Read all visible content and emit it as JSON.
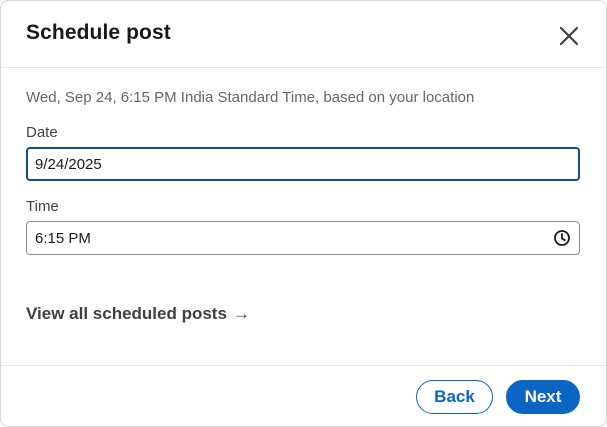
{
  "dialog": {
    "title": "Schedule post",
    "close_icon": "close-icon",
    "info_text": "Wed, Sep 24, 6:15 PM India Standard Time, based on your location"
  },
  "date": {
    "label": "Date",
    "value": "9/24/2025"
  },
  "time": {
    "label": "Time",
    "value": "6:15 PM",
    "icon": "clock-icon"
  },
  "link": {
    "label": "View all scheduled posts",
    "arrow": "→"
  },
  "footer": {
    "back_label": "Back",
    "next_label": "Next"
  },
  "colors": {
    "primary": "#0a66c2",
    "focus_border": "#0a4e8c",
    "muted_text": "#666666"
  }
}
